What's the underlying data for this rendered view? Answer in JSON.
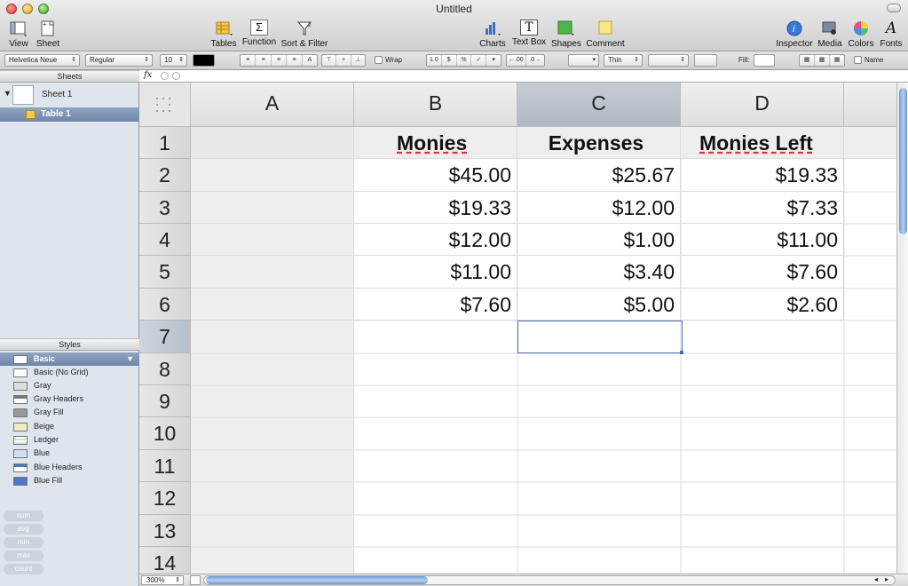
{
  "window": {
    "title": "Untitled"
  },
  "toolbar": {
    "view": "View",
    "sheet": "Sheet",
    "tables": "Tables",
    "function": "Function",
    "sort_filter": "Sort & Filter",
    "charts": "Charts",
    "text_box": "Text Box",
    "shapes": "Shapes",
    "comment": "Comment",
    "inspector": "Inspector",
    "media": "Media",
    "colors": "Colors",
    "fonts": "Fonts",
    "function_glyph": "Σ",
    "text_box_glyph": "T",
    "fonts_glyph": "A"
  },
  "formatbar": {
    "font_family": "Helvetica Neue",
    "font_style": "Regular",
    "font_size": "10",
    "wrap_label": "Wrap",
    "number_formats": [
      "1.0",
      "$",
      "%",
      "✓",
      "▾"
    ],
    "decimals": [
      "←.00",
      ".0→"
    ],
    "stroke": "Thin",
    "fill_label": "Fill:",
    "name_label": "Name"
  },
  "sidebar": {
    "sheets_header": "Sheets",
    "sheet_name": "Sheet 1",
    "table_name": "Table 1",
    "styles_header": "Styles",
    "styles": [
      "Basic",
      "Basic (No Grid)",
      "Gray",
      "Gray Headers",
      "Gray Fill",
      "Beige",
      "Ledger",
      "Blue",
      "Blue Headers",
      "Blue Fill"
    ],
    "selected_style": "Basic",
    "functions": [
      "sum",
      "avg",
      "min",
      "max",
      "count"
    ]
  },
  "formula_bar": {
    "fx_label": "fx"
  },
  "grid": {
    "columns": [
      "A",
      "B",
      "C",
      "D"
    ],
    "rows": [
      "1",
      "2",
      "3",
      "4",
      "5",
      "6",
      "7",
      "8",
      "9",
      "10",
      "11",
      "12",
      "13",
      "14"
    ],
    "headers": [
      "Monies",
      "Expenses",
      "Monies Left"
    ],
    "values": [
      [
        "$45.00",
        "$25.67",
        "$19.33"
      ],
      [
        "$19.33",
        "$12.00",
        "$7.33"
      ],
      [
        "$12.00",
        "$1.00",
        "$11.00"
      ],
      [
        "$11.00",
        "$3.40",
        "$7.60"
      ],
      [
        "$7.60",
        "$5.00",
        "$2.60"
      ]
    ],
    "selected_cell": "C7"
  },
  "statusbar": {
    "zoom": "300%"
  }
}
